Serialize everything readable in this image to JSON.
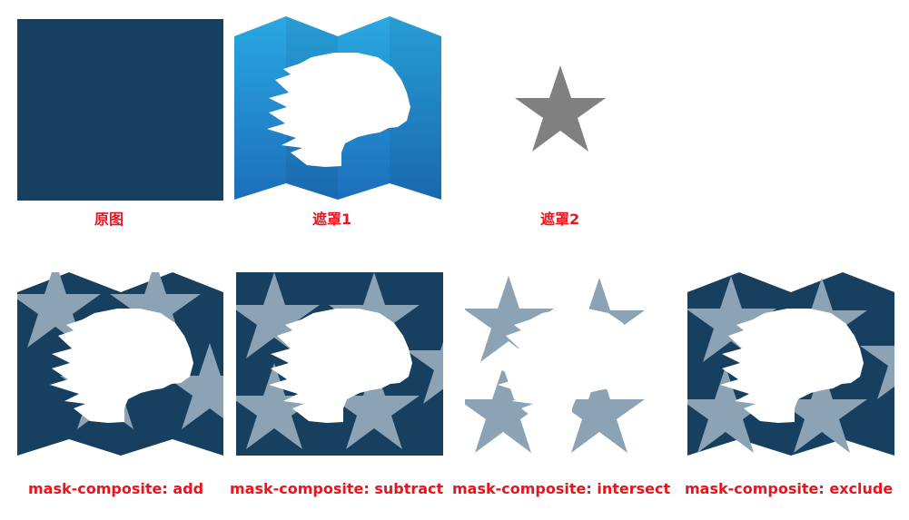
{
  "labels": {
    "original": "原图",
    "mask1": "遮罩1",
    "mask2": "遮罩2",
    "add": "mask-composite: add",
    "subtract": "mask-composite: subtract",
    "intersect": "mask-composite: intersect",
    "exclude": "mask-composite: exclude"
  },
  "colors": {
    "base": "#173f5f",
    "label": "#e8141e",
    "star_mask": "#808080",
    "gradient_top": "#2aa4df",
    "gradient_bottom": "#1b6fb8",
    "star_faded": "#8ba3b4"
  }
}
